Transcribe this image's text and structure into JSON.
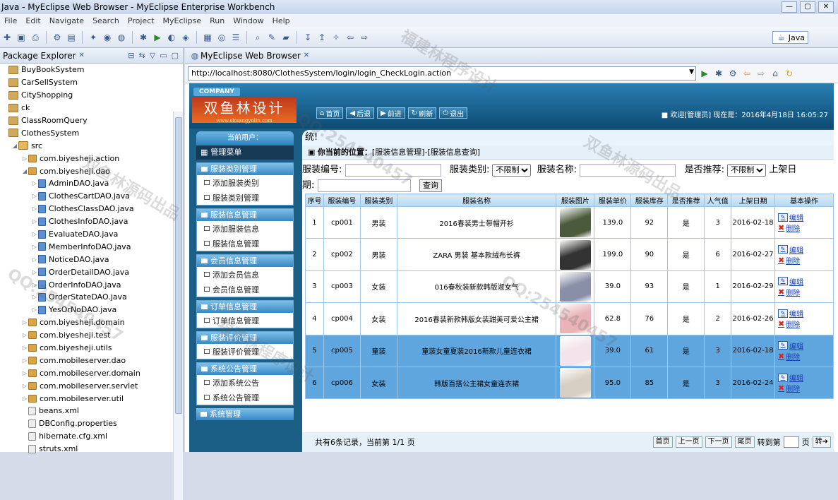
{
  "window": {
    "title": "Java - MyEclipse Web Browser - MyEclipse Enterprise Workbench",
    "controls": [
      "—",
      "▢",
      "✕"
    ]
  },
  "menubar": [
    "File",
    "Edit",
    "Navigate",
    "Search",
    "Project",
    "MyEclipse",
    "Run",
    "Window",
    "Help"
  ],
  "perspective": "Java",
  "package_explorer": {
    "title": "Package Explorer",
    "items": [
      {
        "label": "BuyBookSystem",
        "type": "proj",
        "indent": 0,
        "twisty": ""
      },
      {
        "label": "CarSellSystem",
        "type": "proj",
        "indent": 0,
        "twisty": ""
      },
      {
        "label": "CityShopping",
        "type": "proj",
        "indent": 0,
        "twisty": ""
      },
      {
        "label": "ck",
        "type": "proj",
        "indent": 0,
        "twisty": ""
      },
      {
        "label": "ClassRoomQuery",
        "type": "proj",
        "indent": 0,
        "twisty": ""
      },
      {
        "label": "ClothesSystem",
        "type": "proj",
        "indent": 0,
        "twisty": ""
      },
      {
        "label": "src",
        "type": "src",
        "indent": 1,
        "twisty": "◢"
      },
      {
        "label": "com.biyesheji.action",
        "type": "pkgi",
        "indent": 2,
        "twisty": "▷"
      },
      {
        "label": "com.biyesheji.dao",
        "type": "pkgi",
        "indent": 2,
        "twisty": "◢"
      },
      {
        "label": "AdminDAO.java",
        "type": "java",
        "indent": 3,
        "twisty": "▷"
      },
      {
        "label": "ClothesCartDAO.java",
        "type": "java",
        "indent": 3,
        "twisty": "▷"
      },
      {
        "label": "ClothesClassDAO.java",
        "type": "java",
        "indent": 3,
        "twisty": "▷"
      },
      {
        "label": "ClothesInfoDAO.java",
        "type": "java",
        "indent": 3,
        "twisty": "▷"
      },
      {
        "label": "EvaluateDAO.java",
        "type": "java",
        "indent": 3,
        "twisty": "▷"
      },
      {
        "label": "MemberInfoDAO.java",
        "type": "java",
        "indent": 3,
        "twisty": "▷"
      },
      {
        "label": "NoticeDAO.java",
        "type": "java",
        "indent": 3,
        "twisty": "▷"
      },
      {
        "label": "OrderDetailDAO.java",
        "type": "java",
        "indent": 3,
        "twisty": "▷"
      },
      {
        "label": "OrderInfoDAO.java",
        "type": "java",
        "indent": 3,
        "twisty": "▷"
      },
      {
        "label": "OrderStateDAO.java",
        "type": "java",
        "indent": 3,
        "twisty": "▷"
      },
      {
        "label": "YesOrNoDAO.java",
        "type": "java",
        "indent": 3,
        "twisty": "▷"
      },
      {
        "label": "com.biyesheji.domain",
        "type": "pkgi",
        "indent": 2,
        "twisty": "▷"
      },
      {
        "label": "com.biyesheji.test",
        "type": "pkgi",
        "indent": 2,
        "twisty": "▷"
      },
      {
        "label": "com.biyesheji.utils",
        "type": "pkgi",
        "indent": 2,
        "twisty": "▷"
      },
      {
        "label": "com.mobileserver.dao",
        "type": "pkgi",
        "indent": 2,
        "twisty": "▷"
      },
      {
        "label": "com.mobileserver.domain",
        "type": "pkgi",
        "indent": 2,
        "twisty": "▷"
      },
      {
        "label": "com.mobileserver.servlet",
        "type": "pkgi",
        "indent": 2,
        "twisty": "▷"
      },
      {
        "label": "com.mobileserver.util",
        "type": "pkgi",
        "indent": 2,
        "twisty": "▷"
      },
      {
        "label": "beans.xml",
        "type": "file",
        "indent": 2,
        "twisty": ""
      },
      {
        "label": "DBConfig.properties",
        "type": "file",
        "indent": 2,
        "twisty": ""
      },
      {
        "label": "hibernate.cfg.xml",
        "type": "file",
        "indent": 2,
        "twisty": ""
      },
      {
        "label": "struts.xml",
        "type": "file",
        "indent": 2,
        "twisty": ""
      }
    ]
  },
  "browser": {
    "tab_title": "MyEclipse Web Browser",
    "url": "http://localhost:8080/ClothesSystem/login/login_CheckLogin.action"
  },
  "site": {
    "company": "COMPANY",
    "logo_text": "双鱼林设计",
    "logo_url": "www.shuangyulin.com",
    "nav_buttons": [
      "首页",
      "后退",
      "前进",
      "刷新",
      "退出"
    ],
    "welcome": "欢迎[管理员]   现在是：2016年4月18日 16:05:27",
    "header_tail": "统!",
    "current_user": "当前用户：",
    "menu_title": "管理菜单",
    "menu_groups": [
      {
        "title": "服装类别管理",
        "items": [
          "添加服装类别",
          "服装类别管理"
        ]
      },
      {
        "title": "服装信息管理",
        "items": [
          "添加服装信息",
          "服装信息管理"
        ]
      },
      {
        "title": "会员信息管理",
        "items": [
          "添加会员信息",
          "会员信息管理"
        ]
      },
      {
        "title": "订单信息管理",
        "items": [
          "订单信息管理"
        ]
      },
      {
        "title": "服装评价管理",
        "items": [
          "服装评价管理"
        ]
      },
      {
        "title": "系统公告管理",
        "items": [
          "添加系统公告",
          "系统公告管理"
        ]
      },
      {
        "title": "系统管理",
        "items": []
      }
    ],
    "position_label": "你当前的位置：",
    "position_path": "[服装信息管理]-[服装信息查询]",
    "filter": {
      "code_label": "服装编号:",
      "class_label": "服装类别:",
      "class_value": "不限制",
      "name_label": "服装名称:",
      "recommend_label": "是否推荐:",
      "recommend_value": "不限制",
      "date_label": "上架日",
      "date_label_wrap": "期:",
      "query_button": "查询"
    },
    "table": {
      "headers": [
        "序号",
        "服装编号",
        "服装类别",
        "服装名称",
        "服装图片",
        "服装单价",
        "服装库存",
        "是否推荐",
        "人气值",
        "上架日期",
        "基本操作"
      ],
      "rows": [
        {
          "no": "1",
          "code": "cp001",
          "class": "男装",
          "name": "2016春装男士带帽开衫",
          "price": "139.0",
          "stock": "92",
          "rec": "是",
          "pop": "3",
          "date": "2016-02-18",
          "color": "#4a5a3a",
          "selected": false
        },
        {
          "no": "2",
          "code": "cp002",
          "class": "男装",
          "name": "ZARA 男装 基本款绒布长裤",
          "price": "199.0",
          "stock": "90",
          "rec": "是",
          "pop": "6",
          "date": "2016-02-27",
          "color": "#333333",
          "selected": false
        },
        {
          "no": "3",
          "code": "cp003",
          "class": "女装",
          "name": "016春秋装新款韩版淑女气",
          "price": "39.0",
          "stock": "93",
          "rec": "是",
          "pop": "1",
          "date": "2016-02-29",
          "color": "#8a8fa8",
          "selected": false
        },
        {
          "no": "4",
          "code": "cp004",
          "class": "女装",
          "name": "2016春装新款韩版女装甜美可爱公主裙",
          "price": "62.8",
          "stock": "76",
          "rec": "是",
          "pop": "2",
          "date": "2016-02-26",
          "color": "#e8b4b8",
          "selected": false
        },
        {
          "no": "5",
          "code": "cp005",
          "class": "童装",
          "name": "童装女童夏装2016新款儿童连衣裙",
          "price": "39.0",
          "stock": "61",
          "rec": "是",
          "pop": "3",
          "date": "2016-02-18",
          "color": "#f3e3ea",
          "selected": true
        },
        {
          "no": "6",
          "code": "cp006",
          "class": "女装",
          "name": "韩版百搭公主裙女童连衣裙",
          "price": "95.0",
          "stock": "85",
          "rec": "是",
          "pop": "3",
          "date": "2016-02-24",
          "color": "#d8cfc4",
          "selected": true
        }
      ],
      "edit_label": "编辑",
      "delete_label": "删除"
    },
    "pager": {
      "summary": "共有6条记录，当前第 1/1 页",
      "first": "首页",
      "prev": "上一页",
      "next": "下一页",
      "last": "尾页",
      "goto_label": "转到第",
      "page_unit": "页",
      "go": "转"
    }
  },
  "watermarks": [
    "双鱼林源码出品",
    "QQ:254540457",
    "福建林程序设计"
  ]
}
